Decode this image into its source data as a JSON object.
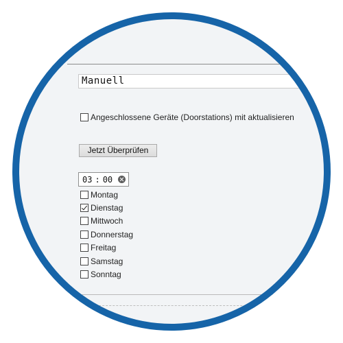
{
  "update": {
    "mode_value": "Manuell",
    "include_devices_label": "Angeschlossene Geräte (Doorstations) mit aktualisieren",
    "include_devices_checked": false,
    "check_now_label": "Jetzt Überprüfen"
  },
  "schedule": {
    "time_hours": "03",
    "time_separator": ":",
    "time_minutes": "00",
    "clear_icon": "clear-icon",
    "days": [
      {
        "label": "Montag",
        "checked": false
      },
      {
        "label": "Dienstag",
        "checked": true
      },
      {
        "label": "Mittwoch",
        "checked": false
      },
      {
        "label": "Donnerstag",
        "checked": false
      },
      {
        "label": "Freitag",
        "checked": false
      },
      {
        "label": "Samstag",
        "checked": false
      },
      {
        "label": "Sonntag",
        "checked": false
      }
    ]
  },
  "colors": {
    "frame_ring": "#1664a8",
    "panel_background": "#f2f4f6"
  }
}
